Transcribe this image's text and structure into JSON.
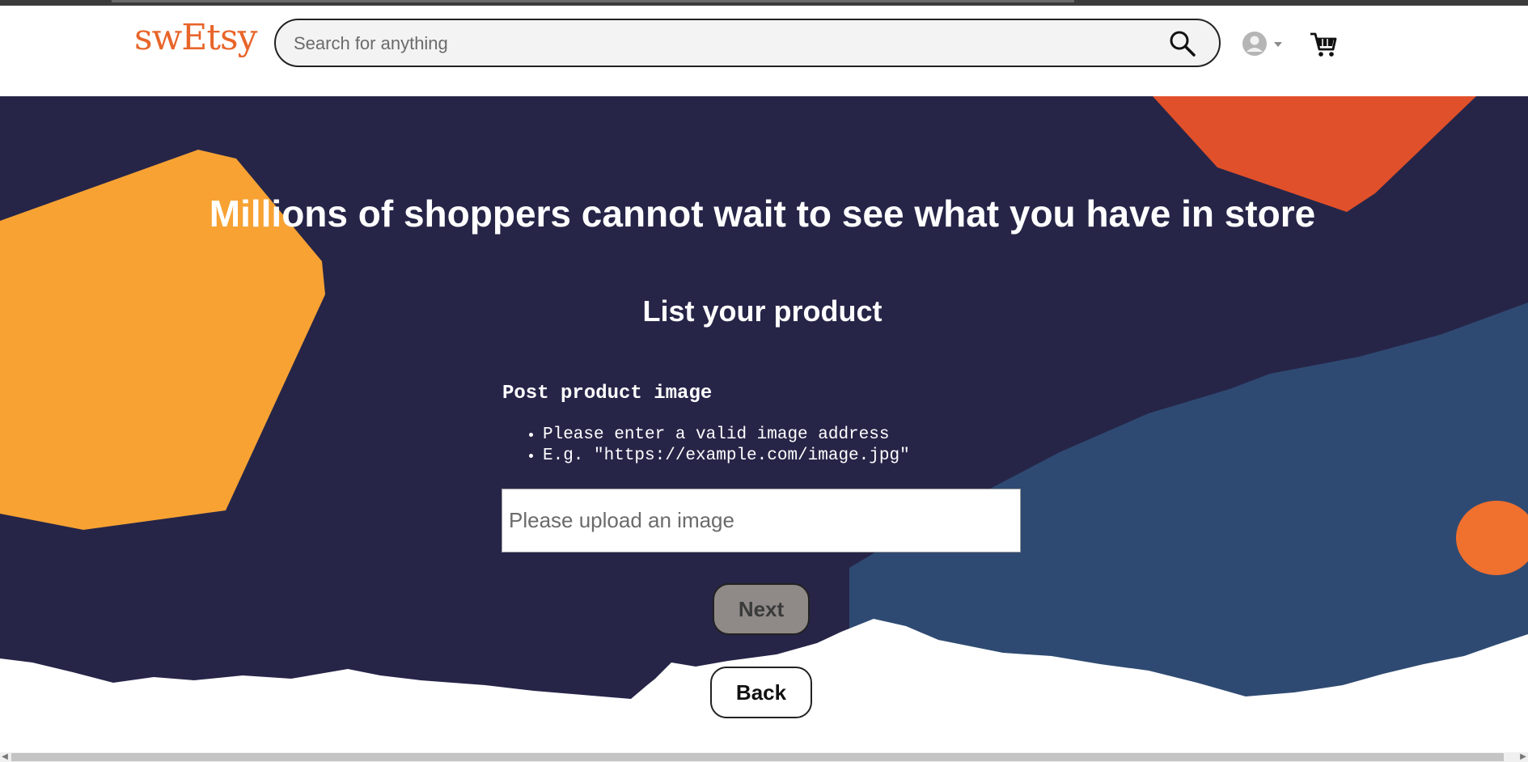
{
  "header": {
    "logo": "swEtsy",
    "search": {
      "placeholder": "Search for anything"
    },
    "icons": {
      "search": "search-icon",
      "account": "user-avatar-icon",
      "dropdown": "caret-down-icon",
      "cart": "shopping-cart-icon"
    }
  },
  "hero": {
    "headline": "Millions of shoppers cannot wait to see what you have in store",
    "title": "List your product"
  },
  "form": {
    "section_title": "Post product image",
    "hints": [
      "Please enter a valid image address",
      "E.g. \"https://example.com/image.jpg\""
    ],
    "image_input": {
      "placeholder": "Please upload an image",
      "value": ""
    },
    "next_label": "Next",
    "back_label": "Back"
  },
  "colors": {
    "brand": "#e8652a",
    "hero_bg": "#262548",
    "blob_orange": "#f7a233",
    "blob_red": "#e0502a",
    "blob_blue": "#2f4a72",
    "next_disabled": "#8f8a88"
  }
}
